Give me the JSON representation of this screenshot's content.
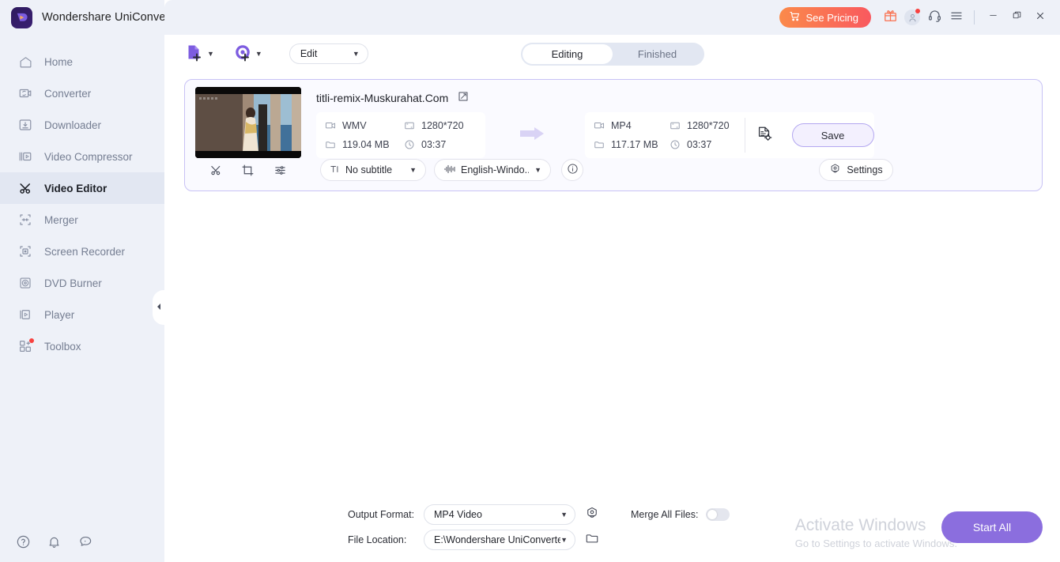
{
  "app": {
    "title": "Wondershare UniConverter",
    "logo_icon": "uniconverter-logo-icon"
  },
  "titlebar": {
    "pricing_label": "See Pricing",
    "cart_icon": "cart-icon",
    "gift_icon": "gift-icon",
    "account_icon": "account-icon",
    "support_icon": "headset-icon",
    "menu_icon": "hamburger-menu-icon",
    "minimize_icon": "minimize-icon",
    "restore_icon": "restore-icon",
    "close_icon": "close-icon",
    "accent_gradient_start": "#fb8a4a",
    "accent_gradient_end": "#f9595f"
  },
  "sidebar": {
    "items": [
      {
        "label": "Home",
        "icon": "home-icon",
        "active": false
      },
      {
        "label": "Converter",
        "icon": "converter-icon",
        "active": false
      },
      {
        "label": "Downloader",
        "icon": "downloader-icon",
        "active": false
      },
      {
        "label": "Video Compressor",
        "icon": "video-compressor-icon",
        "active": false
      },
      {
        "label": "Video Editor",
        "icon": "video-editor-scissors-icon",
        "active": true
      },
      {
        "label": "Merger",
        "icon": "merger-icon",
        "active": false
      },
      {
        "label": "Screen Recorder",
        "icon": "screen-recorder-icon",
        "active": false
      },
      {
        "label": "DVD Burner",
        "icon": "dvd-burner-icon",
        "active": false
      },
      {
        "label": "Player",
        "icon": "player-icon",
        "active": false
      },
      {
        "label": "Toolbox",
        "icon": "toolbox-icon",
        "active": false
      }
    ],
    "bottom_icons": [
      "help-icon",
      "notification-bell-icon",
      "feedback-icon"
    ],
    "collapse_icon": "chevron-left-icon",
    "active_bg": "#e2e7f2",
    "bg": "#eef1f8"
  },
  "toolbar": {
    "add_file_icon": "add-file-icon",
    "add_file_caret": "chevron-down-icon",
    "add_media_icon": "add-from-device-icon",
    "add_media_caret": "chevron-down-icon",
    "edit_select_value": "Edit",
    "edit_select_caret": "chevron-down-icon",
    "tabs": [
      {
        "label": "Editing",
        "active": true
      },
      {
        "label": "Finished",
        "active": false
      }
    ]
  },
  "file_card": {
    "title": "titli-remix-Muskurahat.Com",
    "rename_icon": "edit-pencil-icon",
    "thumbnail_alt": "video-thumbnail",
    "tools": [
      {
        "icon": "trim-scissors-icon",
        "name": "trim-tool"
      },
      {
        "icon": "crop-icon",
        "name": "crop-tool"
      },
      {
        "icon": "effect-sliders-icon",
        "name": "effect-tool"
      }
    ],
    "source": {
      "format": "WMV",
      "format_icon": "video-format-icon",
      "resolution": "1280*720",
      "resolution_icon": "resolution-icon",
      "size": "119.04 MB",
      "size_icon": "folder-icon",
      "duration": "03:37",
      "duration_icon": "clock-icon"
    },
    "convert_arrow_icon": "arrow-right-icon",
    "output": {
      "format": "MP4",
      "format_icon": "video-format-icon",
      "resolution": "1280*720",
      "resolution_icon": "resolution-icon",
      "size": "117.17 MB",
      "size_icon": "folder-icon",
      "duration": "03:37",
      "duration_icon": "clock-icon"
    },
    "output_settings_icon": "file-settings-icon",
    "save_label": "Save",
    "subtitle_select": {
      "value": "No subtitle",
      "icon": "subtitle-text-icon",
      "caret": "chevron-down-icon"
    },
    "audio_select": {
      "value": "English-Windo...",
      "icon": "audio-wave-icon",
      "caret": "chevron-down-icon"
    },
    "info_icon": "info-circle-icon",
    "settings_label": "Settings",
    "settings_icon": "settings-gear-icon",
    "border_color": "#c8c2f5"
  },
  "footer": {
    "output_format_label": "Output Format:",
    "output_format_value": "MP4 Video",
    "output_format_caret": "chevron-down-icon",
    "output_format_settings_icon": "format-settings-icon",
    "file_location_label": "File Location:",
    "file_location_value": "E:\\Wondershare UniConverter",
    "file_location_caret": "chevron-down-icon",
    "file_location_browse_icon": "folder-open-icon",
    "merge_label": "Merge All Files:",
    "merge_enabled": false,
    "start_all_label": "Start All",
    "start_all_color": "#8b6ede"
  },
  "watermark": {
    "line1": "Activate Windows",
    "line2": "Go to Settings to activate Windows."
  }
}
